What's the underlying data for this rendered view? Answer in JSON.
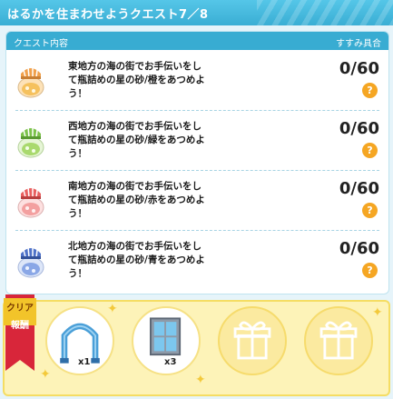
{
  "window": {
    "title": "はるかを住まわせようクエスト7／8"
  },
  "quest_panel": {
    "header_left": "クエスト内容",
    "header_right": "すすみ具合",
    "quests": [
      {
        "line1": "東地方の海の街でお手伝いをし",
        "line2": "て瓶詰めの星の砂/橙をあつめよ",
        "line3": "う！",
        "progress": "0/60",
        "help": "?",
        "color": "#f0a04b",
        "icon": "orange-star-sand-jar-icon"
      },
      {
        "line1": "西地方の海の街でお手伝いをし",
        "line2": "て瓶詰めの星の砂/緑をあつめよ",
        "line3": "う！",
        "progress": "0/60",
        "help": "?",
        "color": "#7cc24b",
        "icon": "green-star-sand-jar-icon"
      },
      {
        "line1": "南地方の海の街でお手伝いをし",
        "line2": "て瓶詰めの星の砂/赤をあつめよ",
        "line3": "う！",
        "progress": "0/60",
        "help": "?",
        "color": "#e86060",
        "icon": "red-star-sand-jar-icon"
      },
      {
        "line1": "北地方の海の街でお手伝いをし",
        "line2": "て瓶詰めの星の砂/青をあつめよ",
        "line3": "う！",
        "progress": "0/60",
        "help": "?",
        "color": "#4f72c8",
        "icon": "blue-star-sand-jar-icon"
      }
    ]
  },
  "rewards": {
    "label_line1": "クリア",
    "label_line2": "報酬",
    "items": [
      {
        "icon": "blue-arch-furniture-icon",
        "qty": "x1"
      },
      {
        "icon": "window-panel-furniture-icon",
        "qty": "x3"
      },
      {
        "icon": "gift-box-icon",
        "qty": ""
      },
      {
        "icon": "gift-box-icon",
        "qty": ""
      }
    ]
  }
}
